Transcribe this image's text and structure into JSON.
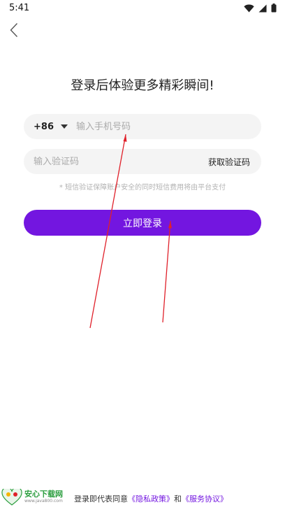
{
  "status": {
    "time": "5:41"
  },
  "page": {
    "title": "登录后体验更多精彩瞬间!"
  },
  "phone": {
    "country_code": "+86",
    "placeholder": "输入手机号码"
  },
  "code": {
    "placeholder": "输入验证码",
    "get_code_label": "获取验证码"
  },
  "note": "* 短信验证保障账户安全的同时短信费用将由平台支付",
  "login": {
    "label": "立即登录"
  },
  "footer": {
    "agree_prefix": "登录即代表同意",
    "privacy_link": "《隐私政策》",
    "and": "和",
    "service_link": "《服务协议》"
  },
  "watermark": {
    "name": "安心下载网",
    "url": "www.java800.com"
  },
  "colors": {
    "accent": "#7316e0",
    "annotation": "#e0202a"
  }
}
